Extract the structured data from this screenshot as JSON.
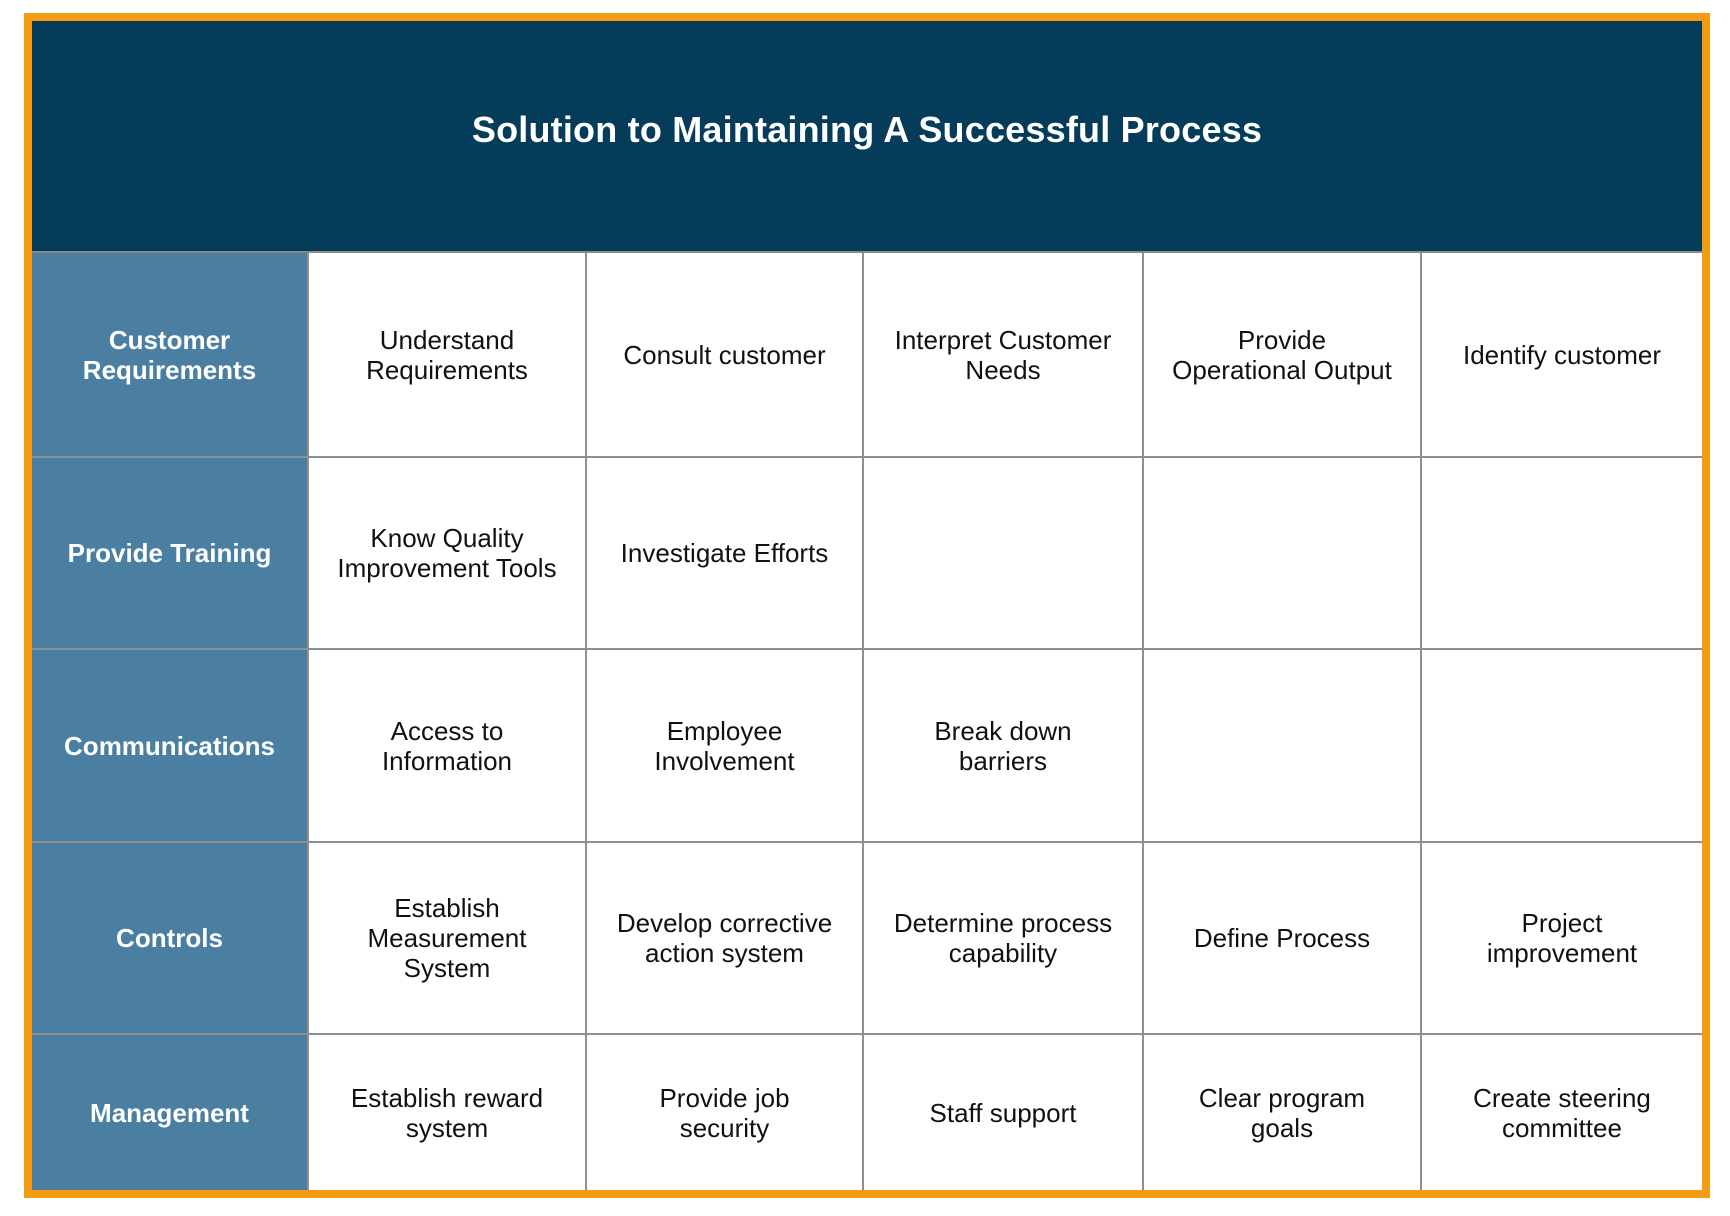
{
  "title": "Solution to Maintaining A Successful Process",
  "colors": {
    "border_accent": "#f39c12",
    "header_bg": "#043c59",
    "row_header_bg": "#4a7fa2",
    "grid_line": "#8f8f8f"
  },
  "rows": [
    {
      "label": "Customer\nRequirements",
      "cells": [
        "Understand\nRequirements",
        "Consult customer",
        "Interpret Customer\nNeeds",
        "Provide\nOperational Output",
        "Identify customer"
      ]
    },
    {
      "label": "Provide Training",
      "cells": [
        "Know Quality\nImprovement Tools",
        "Investigate Efforts",
        "",
        "",
        ""
      ]
    },
    {
      "label": "Communications",
      "cells": [
        "Access to\nInformation",
        "Employee\nInvolvement",
        "Break down\nbarriers",
        "",
        ""
      ]
    },
    {
      "label": "Controls",
      "cells": [
        "Establish\nMeasurement\nSystem",
        "Develop corrective\naction system",
        "Determine process\ncapability",
        "Define Process",
        "Project\nimprovement"
      ]
    },
    {
      "label": "Management",
      "cells": [
        "Establish reward\nsystem",
        "Provide job\nsecurity",
        "Staff support",
        "Clear program\ngoals",
        "Create steering\ncommittee"
      ]
    }
  ]
}
